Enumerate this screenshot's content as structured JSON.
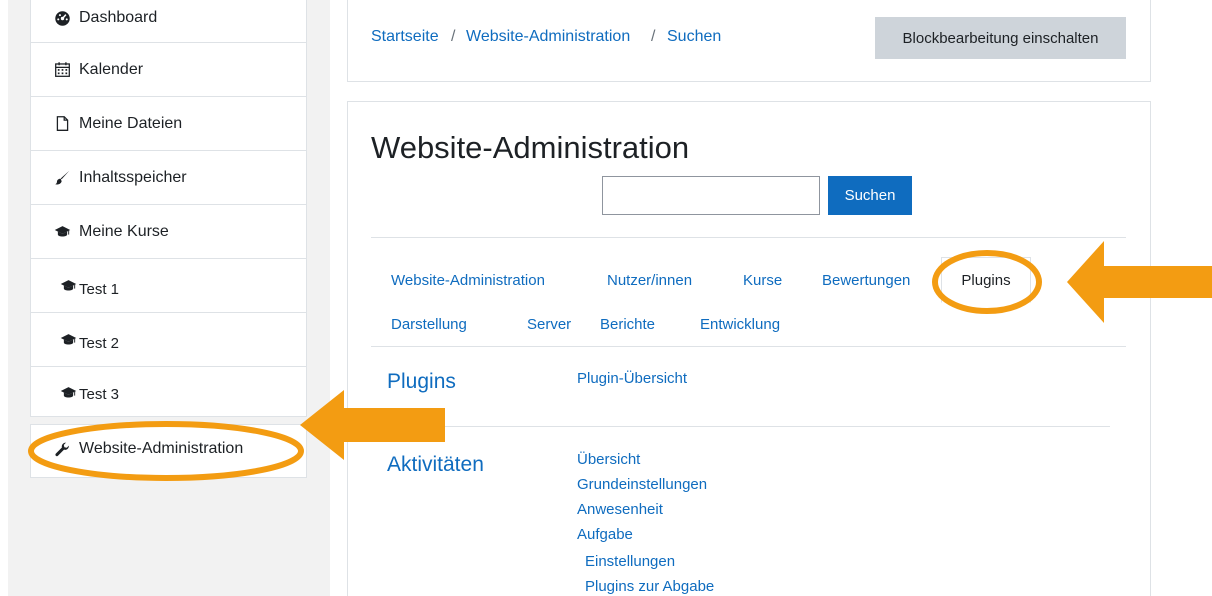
{
  "sidebar": {
    "items": [
      {
        "label": "Dashboard",
        "icon": "dashboard-icon"
      },
      {
        "label": "Kalender",
        "icon": "calendar-icon"
      },
      {
        "label": "Meine Dateien",
        "icon": "file-icon"
      },
      {
        "label": "Inhaltsspeicher",
        "icon": "paintbrush-icon"
      },
      {
        "label": "Meine Kurse",
        "icon": "graduation-cap-icon"
      },
      {
        "label": "Test 1",
        "icon": "graduation-cap-icon"
      },
      {
        "label": "Test 2",
        "icon": "graduation-cap-icon"
      },
      {
        "label": "Test 3",
        "icon": "graduation-cap-icon"
      }
    ],
    "admin": {
      "label": "Website-Administration",
      "icon": "wrench-icon"
    }
  },
  "breadcrumb": {
    "items": [
      "Startseite",
      "Website-Administration",
      "Suchen"
    ],
    "separator": "/"
  },
  "header": {
    "edit_button": "Blockbearbeitung einschalten"
  },
  "main": {
    "title": "Website-Administration",
    "search": {
      "value": "",
      "button": "Suchen"
    },
    "tabs_row1": [
      "Website-Administration",
      "Nutzer/innen",
      "Kurse",
      "Bewertungen",
      "Plugins"
    ],
    "tabs_row2": [
      "Darstellung",
      "Server",
      "Berichte",
      "Entwicklung"
    ],
    "active_tab": "Plugins",
    "sections": [
      {
        "heading": "Plugins",
        "links": [
          "Plugin-Übersicht"
        ]
      },
      {
        "heading": "Aktivitäten",
        "links": [
          "Übersicht",
          "Grundeinstellungen",
          "Anwesenheit",
          "Aufgabe",
          "Einstellungen",
          "Plugins zur Abgabe"
        ]
      }
    ]
  },
  "colors": {
    "accent": "#0f6cbf",
    "highlight": "#f39c12",
    "edit_button_bg": "#ced4da"
  }
}
